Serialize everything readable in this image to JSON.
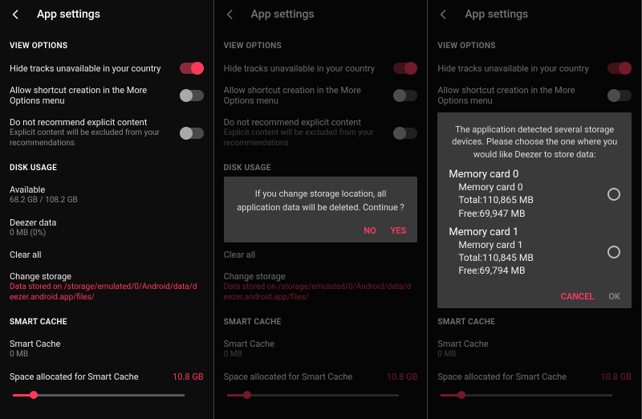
{
  "header": {
    "title": "App settings"
  },
  "sections": {
    "view_options": "VIEW OPTIONS",
    "disk_usage": "DISK USAGE",
    "smart_cache": "SMART CACHE"
  },
  "view_options": {
    "hide_tracks": {
      "title": "Hide tracks unavailable in your country"
    },
    "shortcut": {
      "title": "Allow shortcut creation in the More Options menu"
    },
    "explicit": {
      "title": "Do not recommend explicit content",
      "sub": "Explicit content will be excluded from your recommendations"
    }
  },
  "disk": {
    "available": {
      "title": "Available",
      "sub": "68.2 GB / 108.2 GB"
    },
    "deezer_data": {
      "title": "Deezer data",
      "sub": "0 MB (0%)"
    },
    "clear_all": {
      "title": "Clear all"
    },
    "change_storage": {
      "title": "Change storage",
      "sub": "Data stored on /storage/emulated/0/Android/data/deezer.android.app/files/"
    }
  },
  "cache": {
    "smart": {
      "title": "Smart Cache",
      "sub": "0 MB"
    },
    "allocated": {
      "title": "Space allocated for Smart Cache",
      "value": "10.8 GB"
    }
  },
  "modal_confirm": {
    "message": "If you change storage location, all application data will be deleted. Continue ?",
    "no": "NO",
    "yes": "YES"
  },
  "modal_storage": {
    "message": "The application detected several storage devices. Please choose the one where you would like Deezer to store data:",
    "opts": [
      {
        "name": "Memory card 0",
        "label": "Memory card 0",
        "total": "Total:110,865 MB",
        "free": "Free:69,947 MB"
      },
      {
        "name": "Memory card 1",
        "label": "Memory card 1",
        "total": "Total:110,845 MB",
        "free": "Free:69,794 MB"
      }
    ],
    "cancel": "CANCEL",
    "ok": "OK"
  }
}
